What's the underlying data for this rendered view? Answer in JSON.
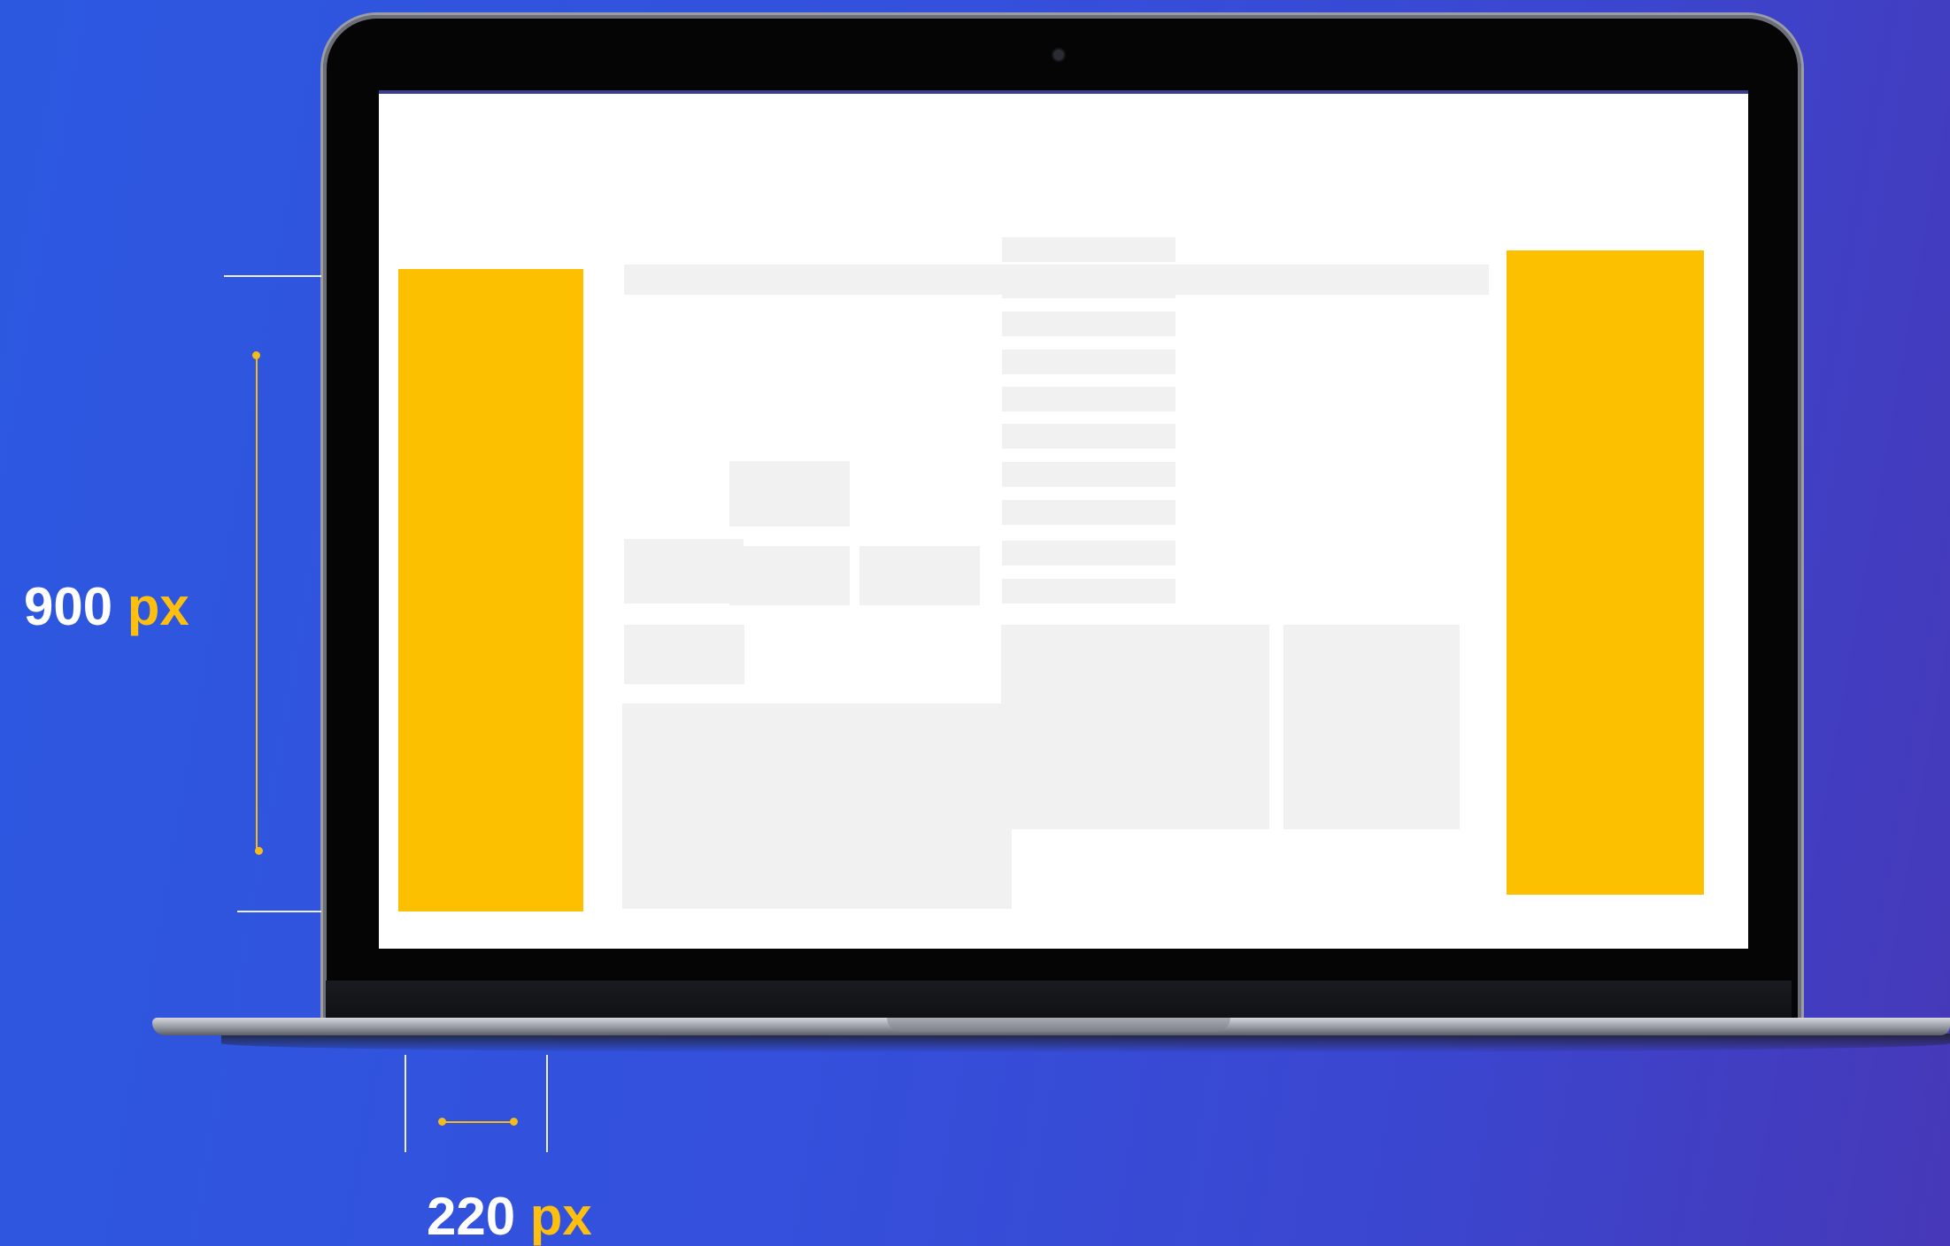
{
  "colors": {
    "background": "#3050dc",
    "ad_slot": "#fdc000",
    "placeholder": "#f1f1f1",
    "accent": "#ffbf0f"
  },
  "height_label": {
    "value": "900",
    "unit": "px"
  },
  "width_label": {
    "value": "220",
    "unit": "px"
  }
}
